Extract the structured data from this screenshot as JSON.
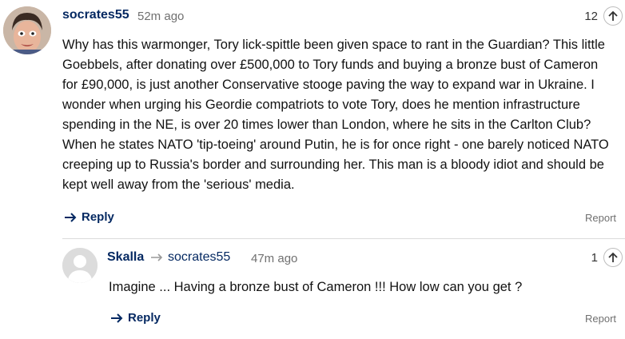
{
  "comments": [
    {
      "username": "socrates55",
      "timestamp": "52m ago",
      "recommend_count": "12",
      "body": "Why has this warmonger, Tory lick-spittle been given space to rant in the Guardian? This little Goebbels, after donating over £500,000 to Tory funds and buying a bronze bust of Cameron for £90,000, is just another Conservative stooge paving the way to expand war in Ukraine. I wonder when urging his Geordie compatriots to vote Tory, does he mention infrastructure spending in the NE, is over 20 times lower than London, where he sits in the Carlton Club? When he states NATO 'tip-toeing' around Putin, he is for once right - one barely noticed NATO creeping up to Russia's border and surrounding her. This man is a bloody idiot and should be kept well away from the 'serious' media.",
      "reply_label": "Reply",
      "report_label": "Report"
    },
    {
      "username": "Skalla",
      "reply_to": "socrates55",
      "timestamp": "47m ago",
      "recommend_count": "1",
      "body": "Imagine ... Having a bronze bust of Cameron !!! How low can you get ?",
      "reply_label": "Reply",
      "report_label": "Report"
    }
  ],
  "colors": {
    "brand_blue": "#052962",
    "muted_text": "#707070",
    "divider": "#dcdcdc"
  },
  "icons": {
    "recommend": "arrow-up-icon",
    "reply": "arrow-right-icon",
    "reply_to": "reply-arrow-icon",
    "avatar_default": "person-silhouette-icon"
  }
}
